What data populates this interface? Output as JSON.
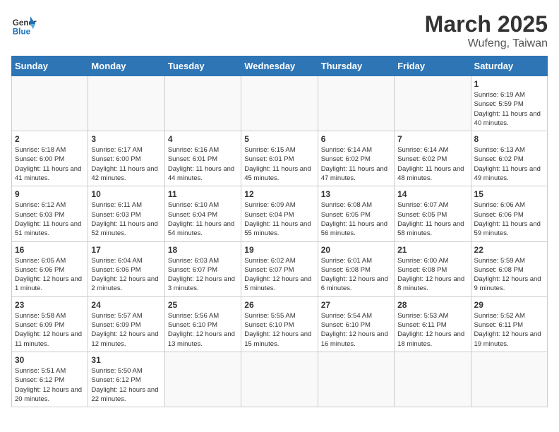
{
  "header": {
    "logo_general": "General",
    "logo_blue": "Blue",
    "title": "March 2025",
    "subtitle": "Wufeng, Taiwan"
  },
  "weekdays": [
    "Sunday",
    "Monday",
    "Tuesday",
    "Wednesday",
    "Thursday",
    "Friday",
    "Saturday"
  ],
  "days": [
    {
      "date": "",
      "info": ""
    },
    {
      "date": "",
      "info": ""
    },
    {
      "date": "",
      "info": ""
    },
    {
      "date": "",
      "info": ""
    },
    {
      "date": "",
      "info": ""
    },
    {
      "date": "",
      "info": ""
    },
    {
      "date": "1",
      "info": "Sunrise: 6:19 AM\nSunset: 5:59 PM\nDaylight: 11 hours\nand 40 minutes."
    },
    {
      "date": "2",
      "info": "Sunrise: 6:18 AM\nSunset: 6:00 PM\nDaylight: 11 hours\nand 41 minutes."
    },
    {
      "date": "3",
      "info": "Sunrise: 6:17 AM\nSunset: 6:00 PM\nDaylight: 11 hours\nand 42 minutes."
    },
    {
      "date": "4",
      "info": "Sunrise: 6:16 AM\nSunset: 6:01 PM\nDaylight: 11 hours\nand 44 minutes."
    },
    {
      "date": "5",
      "info": "Sunrise: 6:15 AM\nSunset: 6:01 PM\nDaylight: 11 hours\nand 45 minutes."
    },
    {
      "date": "6",
      "info": "Sunrise: 6:14 AM\nSunset: 6:02 PM\nDaylight: 11 hours\nand 47 minutes."
    },
    {
      "date": "7",
      "info": "Sunrise: 6:14 AM\nSunset: 6:02 PM\nDaylight: 11 hours\nand 48 minutes."
    },
    {
      "date": "8",
      "info": "Sunrise: 6:13 AM\nSunset: 6:02 PM\nDaylight: 11 hours\nand 49 minutes."
    },
    {
      "date": "9",
      "info": "Sunrise: 6:12 AM\nSunset: 6:03 PM\nDaylight: 11 hours\nand 51 minutes."
    },
    {
      "date": "10",
      "info": "Sunrise: 6:11 AM\nSunset: 6:03 PM\nDaylight: 11 hours\nand 52 minutes."
    },
    {
      "date": "11",
      "info": "Sunrise: 6:10 AM\nSunset: 6:04 PM\nDaylight: 11 hours\nand 54 minutes."
    },
    {
      "date": "12",
      "info": "Sunrise: 6:09 AM\nSunset: 6:04 PM\nDaylight: 11 hours\nand 55 minutes."
    },
    {
      "date": "13",
      "info": "Sunrise: 6:08 AM\nSunset: 6:05 PM\nDaylight: 11 hours\nand 56 minutes."
    },
    {
      "date": "14",
      "info": "Sunrise: 6:07 AM\nSunset: 6:05 PM\nDaylight: 11 hours\nand 58 minutes."
    },
    {
      "date": "15",
      "info": "Sunrise: 6:06 AM\nSunset: 6:06 PM\nDaylight: 11 hours\nand 59 minutes."
    },
    {
      "date": "16",
      "info": "Sunrise: 6:05 AM\nSunset: 6:06 PM\nDaylight: 12 hours\nand 1 minute."
    },
    {
      "date": "17",
      "info": "Sunrise: 6:04 AM\nSunset: 6:06 PM\nDaylight: 12 hours\nand 2 minutes."
    },
    {
      "date": "18",
      "info": "Sunrise: 6:03 AM\nSunset: 6:07 PM\nDaylight: 12 hours\nand 3 minutes."
    },
    {
      "date": "19",
      "info": "Sunrise: 6:02 AM\nSunset: 6:07 PM\nDaylight: 12 hours\nand 5 minutes."
    },
    {
      "date": "20",
      "info": "Sunrise: 6:01 AM\nSunset: 6:08 PM\nDaylight: 12 hours\nand 6 minutes."
    },
    {
      "date": "21",
      "info": "Sunrise: 6:00 AM\nSunset: 6:08 PM\nDaylight: 12 hours\nand 8 minutes."
    },
    {
      "date": "22",
      "info": "Sunrise: 5:59 AM\nSunset: 6:08 PM\nDaylight: 12 hours\nand 9 minutes."
    },
    {
      "date": "23",
      "info": "Sunrise: 5:58 AM\nSunset: 6:09 PM\nDaylight: 12 hours\nand 11 minutes."
    },
    {
      "date": "24",
      "info": "Sunrise: 5:57 AM\nSunset: 6:09 PM\nDaylight: 12 hours\nand 12 minutes."
    },
    {
      "date": "25",
      "info": "Sunrise: 5:56 AM\nSunset: 6:10 PM\nDaylight: 12 hours\nand 13 minutes."
    },
    {
      "date": "26",
      "info": "Sunrise: 5:55 AM\nSunset: 6:10 PM\nDaylight: 12 hours\nand 15 minutes."
    },
    {
      "date": "27",
      "info": "Sunrise: 5:54 AM\nSunset: 6:10 PM\nDaylight: 12 hours\nand 16 minutes."
    },
    {
      "date": "28",
      "info": "Sunrise: 5:53 AM\nSunset: 6:11 PM\nDaylight: 12 hours\nand 18 minutes."
    },
    {
      "date": "29",
      "info": "Sunrise: 5:52 AM\nSunset: 6:11 PM\nDaylight: 12 hours\nand 19 minutes."
    },
    {
      "date": "30",
      "info": "Sunrise: 5:51 AM\nSunset: 6:12 PM\nDaylight: 12 hours\nand 20 minutes."
    },
    {
      "date": "31",
      "info": "Sunrise: 5:50 AM\nSunset: 6:12 PM\nDaylight: 12 hours\nand 22 minutes."
    },
    {
      "date": "",
      "info": ""
    },
    {
      "date": "",
      "info": ""
    },
    {
      "date": "",
      "info": ""
    },
    {
      "date": "",
      "info": ""
    },
    {
      "date": "",
      "info": ""
    }
  ]
}
